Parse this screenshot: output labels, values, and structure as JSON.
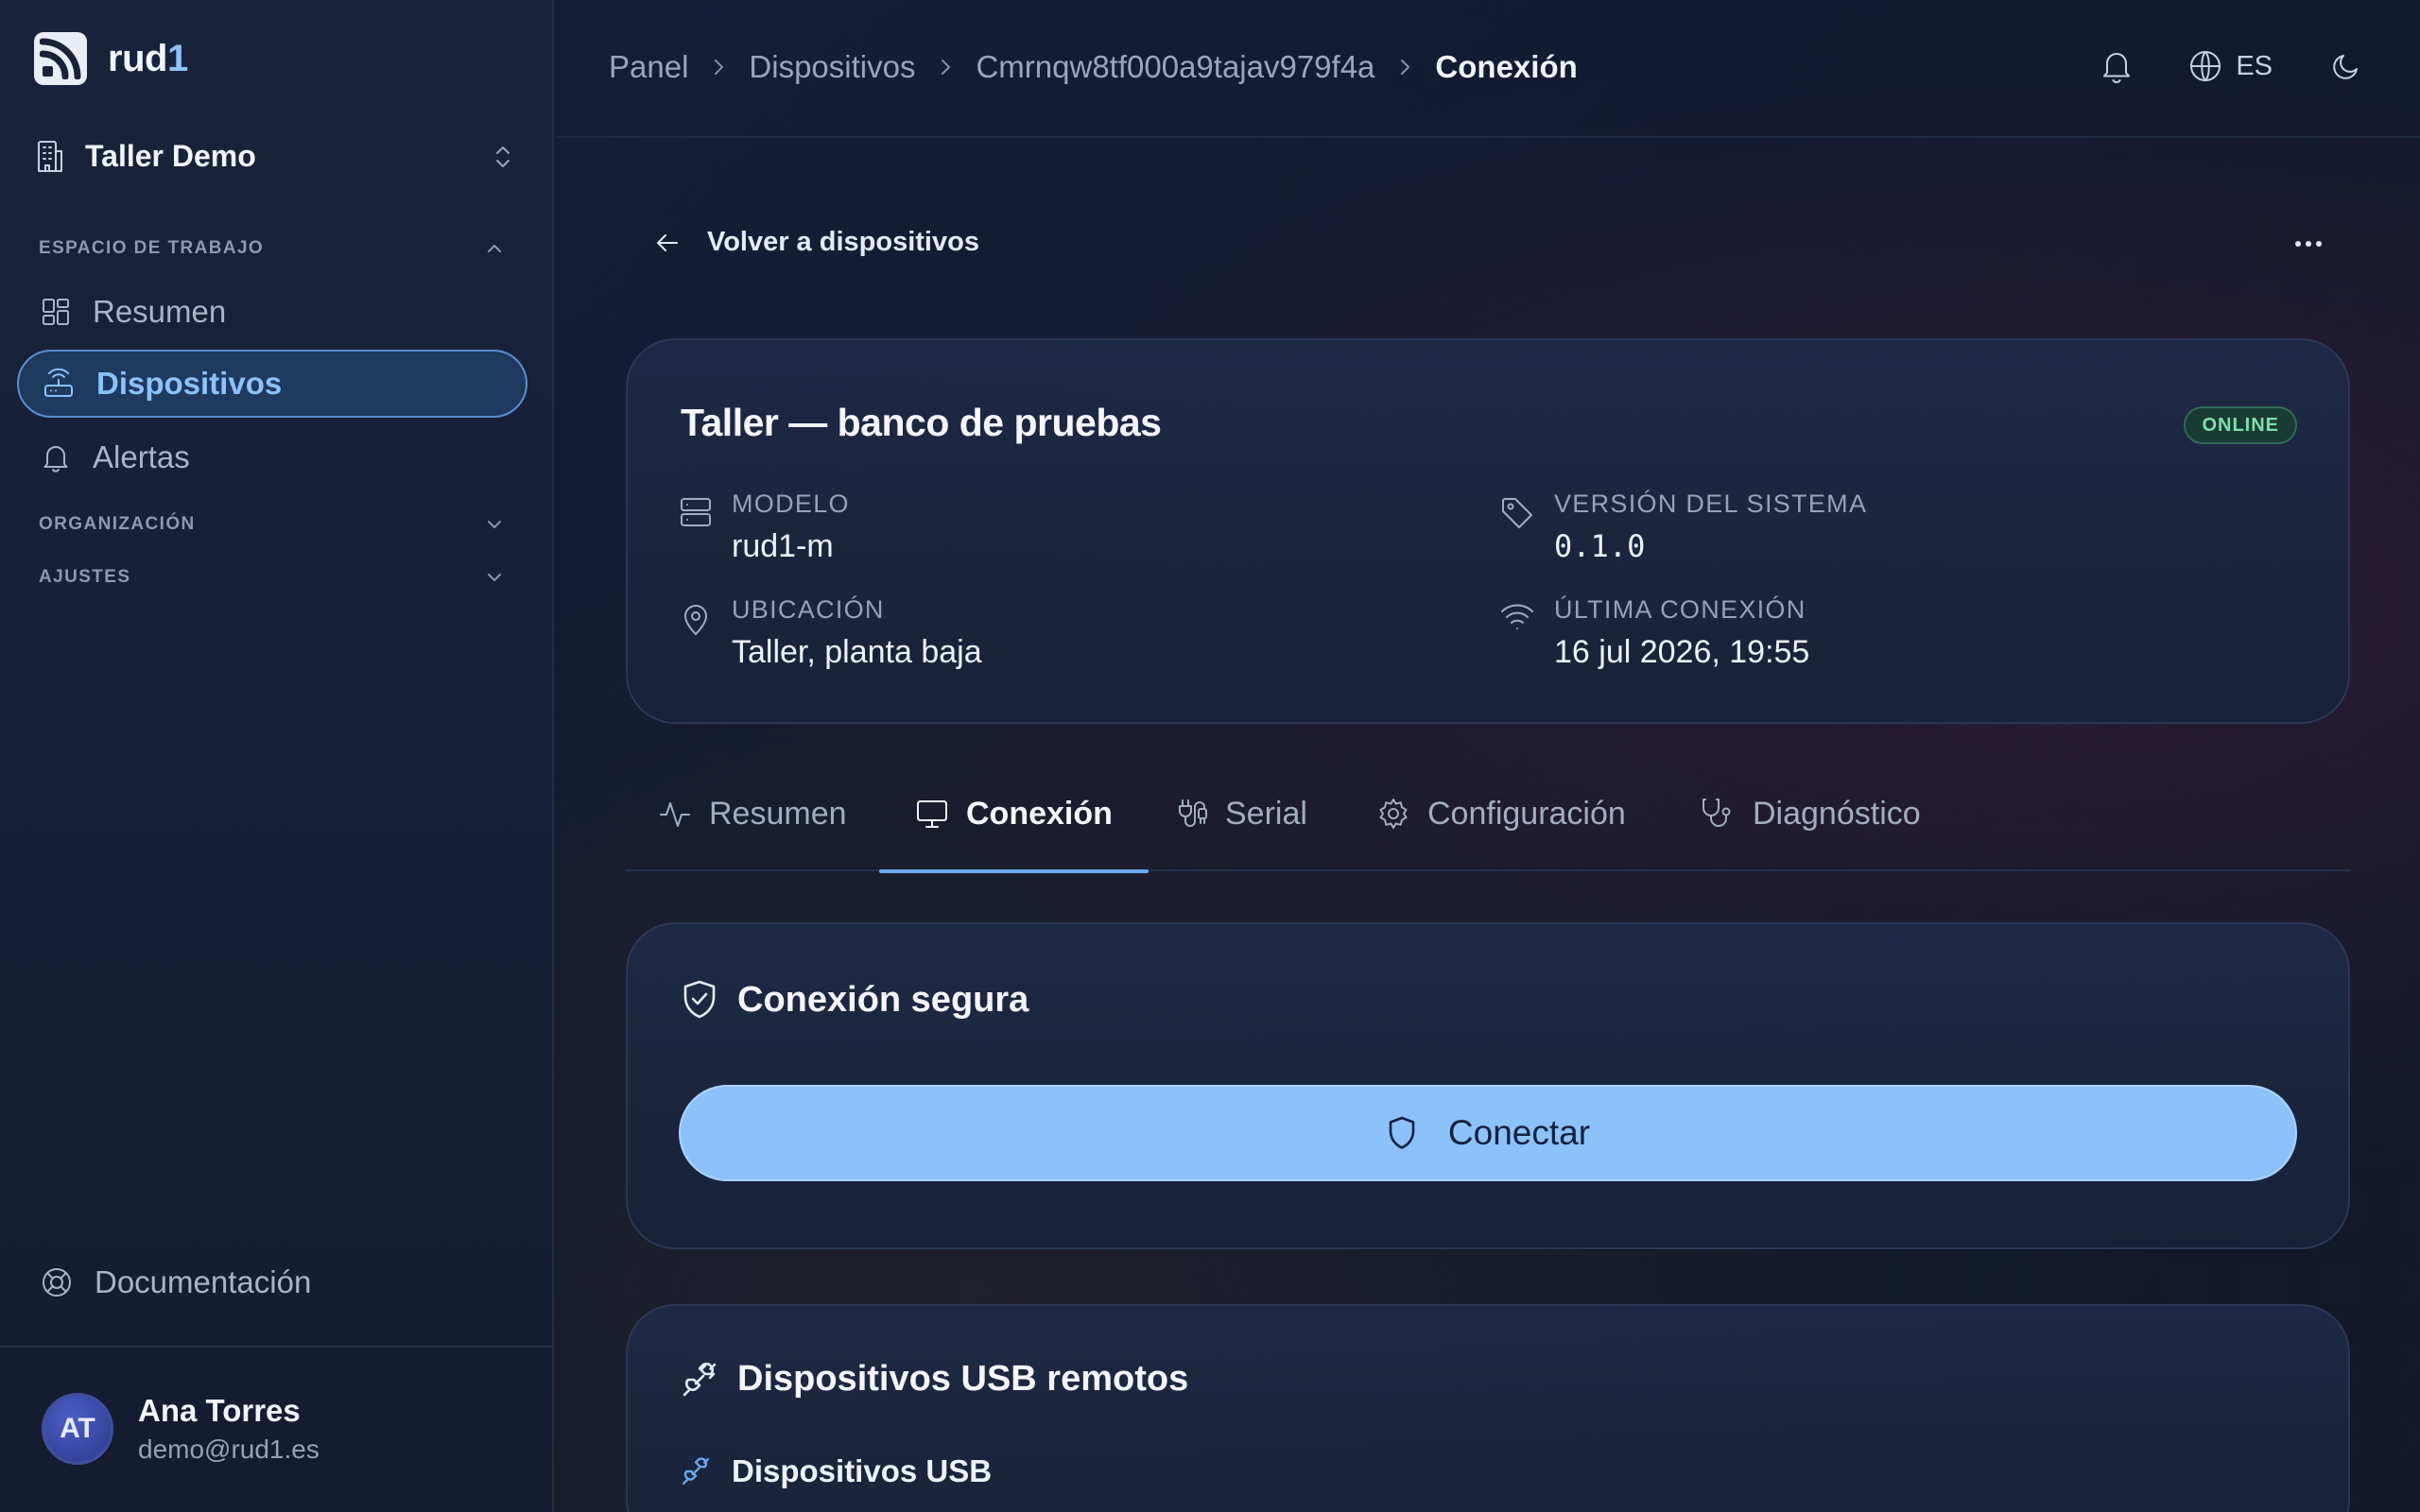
{
  "brand": {
    "name_main": "rud",
    "name_accent": "1"
  },
  "org": {
    "name": "Taller Demo"
  },
  "sidebar": {
    "sections": [
      {
        "label": "ESPACIO DE TRABAJO"
      },
      {
        "label": "ORGANIZACIÓN"
      },
      {
        "label": "AJUSTES"
      }
    ],
    "items": [
      {
        "label": "Resumen",
        "icon": "layout-grid-icon"
      },
      {
        "label": "Dispositivos",
        "icon": "router-icon",
        "active": true
      },
      {
        "label": "Alertas",
        "icon": "bell-icon"
      }
    ],
    "docs_label": "Documentación"
  },
  "user": {
    "initials": "AT",
    "name": "Ana Torres",
    "email": "demo@rud1.es"
  },
  "breadcrumb": [
    "Panel",
    "Dispositivos",
    "Cmrnqw8tf000a9tajav979f4a",
    "Conexión"
  ],
  "topbar": {
    "language": "ES"
  },
  "back_label": "Volver a dispositivos",
  "device": {
    "title": "Taller — banco de pruebas",
    "status": "ONLINE",
    "model_label": "MODELO",
    "model": "rud1-m",
    "version_label": "VERSIÓN DEL SISTEMA",
    "version": "0.1.0",
    "location_label": "UBICACIÓN",
    "location": "Taller, planta baja",
    "last_seen_label": "ÚLTIMA CONEXIÓN",
    "last_seen": "16 jul 2026, 19:55"
  },
  "tabs": [
    {
      "label": "Resumen"
    },
    {
      "label": "Conexión",
      "active": true
    },
    {
      "label": "Serial"
    },
    {
      "label": "Configuración"
    },
    {
      "label": "Diagnóstico"
    }
  ],
  "secure": {
    "title": "Conexión segura",
    "connect_label": "Conectar"
  },
  "usb": {
    "title": "Dispositivos USB remotos",
    "subtitle": "Dispositivos USB"
  },
  "colors": {
    "accent": "#8cc2fb",
    "active_nav": "#1e3a5f",
    "online": "#7de0ad"
  }
}
